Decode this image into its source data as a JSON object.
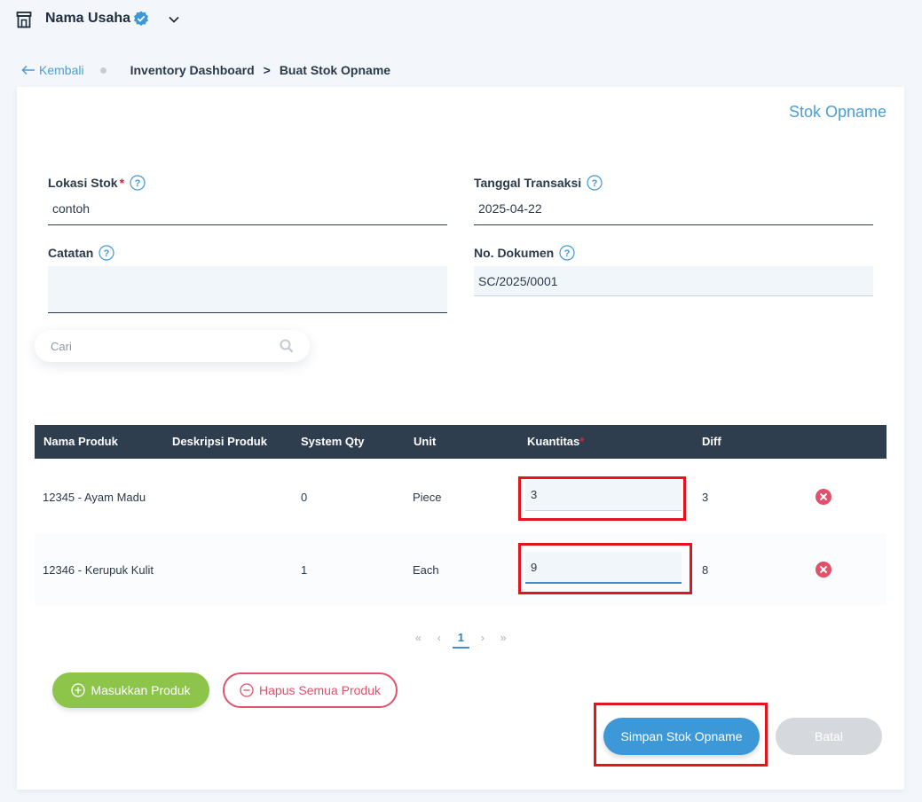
{
  "header": {
    "business_name": "Nama Usaha",
    "icons": {
      "store": "store-icon",
      "verified": "verified-badge-icon",
      "dropdown": "chevron-down-icon"
    }
  },
  "breadcrumb": {
    "back_label": "Kembali",
    "items": [
      "Inventory Dashboard",
      "Buat Stok Opname"
    ],
    "separator": ">"
  },
  "card": {
    "title": "Stok Opname"
  },
  "form": {
    "lokasi": {
      "label": "Lokasi Stok",
      "required_mark": "*",
      "value": "contoh"
    },
    "tanggal": {
      "label": "Tanggal Transaksi",
      "value": "2025-04-22"
    },
    "catatan": {
      "label": "Catatan",
      "value": ""
    },
    "dokumen": {
      "label": "No. Dokumen",
      "value": "SC/2025/0001"
    }
  },
  "search": {
    "placeholder": "Cari"
  },
  "table": {
    "headers": {
      "nama": "Nama Produk",
      "deskripsi": "Deskripsi Produk",
      "system_qty": "System Qty",
      "unit": "Unit",
      "kuantitas": "Kuantitas",
      "kuantitas_required": "*",
      "diff": "Diff"
    },
    "rows": [
      {
        "nama": "12345 - Ayam Madu",
        "deskripsi": "",
        "system_qty": "0",
        "unit": "Piece",
        "kuantitas": "3",
        "diff": "3"
      },
      {
        "nama": "12346 - Kerupuk Kulit",
        "deskripsi": "",
        "system_qty": "1",
        "unit": "Each",
        "kuantitas": "9",
        "diff": "8"
      }
    ]
  },
  "pagination": {
    "first": "«",
    "prev": "‹",
    "current": "1",
    "next": "›",
    "last": "»"
  },
  "buttons": {
    "add": "Masukkan Produk",
    "clear": "Hapus Semua Produk",
    "save": "Simpan Stok Opname",
    "cancel": "Batal"
  },
  "colors": {
    "accent": "#3d98d8",
    "add_green": "#8dc54b",
    "danger": "#e2506a",
    "table_header": "#2f3e4e",
    "highlight_red": "#e2151c"
  }
}
